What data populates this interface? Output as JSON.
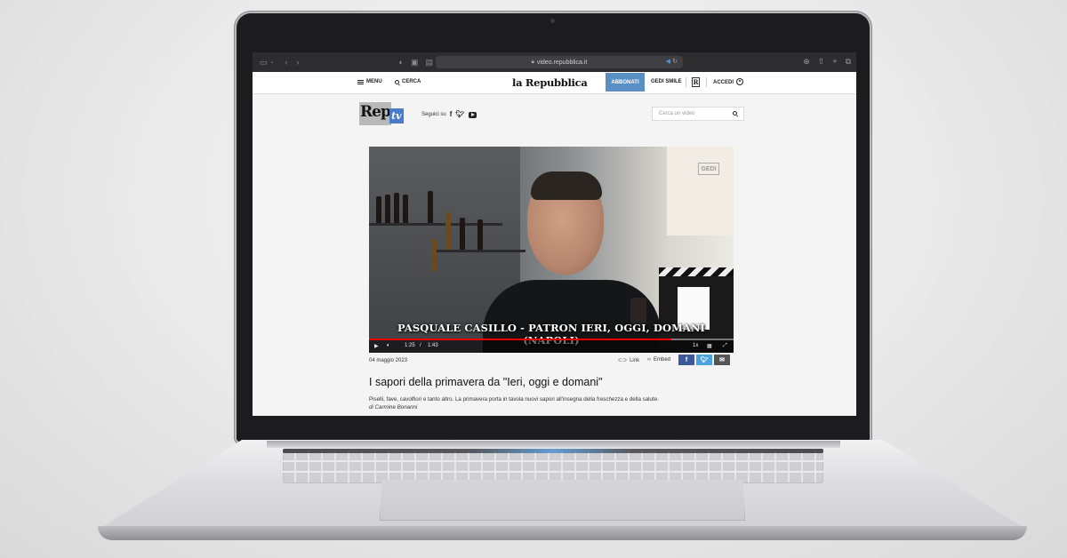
{
  "browser": {
    "url": "video.repubblica.it"
  },
  "header": {
    "menu_label": "MENU",
    "search_label": "CERCA",
    "brand": "la Repubblica",
    "subscribe_label": "ABBONATI",
    "gedi_smile_label": "GEDI SMILE",
    "r_badge": "R",
    "login_label": "ACCEDI"
  },
  "reptv": {
    "logo_rep": "Rep",
    "logo_tv": "tv",
    "follow_label": "Seguici su",
    "social": [
      "facebook-icon",
      "twitter-icon",
      "youtube-icon"
    ],
    "search_placeholder": "Cerca un video"
  },
  "video": {
    "caption": "PASQUALE CASILLO - PATRON IERI, OGGI, DOMANI (NAPOLI)",
    "watermark": "GEDI",
    "current_time": "1:25",
    "time_separator": "/",
    "duration": "1:43",
    "speed": "1x",
    "progress": 0.83
  },
  "article": {
    "date": "04 maggio 2023",
    "link_label": "Link",
    "embed_label": "Embed",
    "title": "I sapori della primavera da \"Ieri, oggi e domani\"",
    "description": "Piselli, fave, cavolfiori e tanto altro. La primavera porta in tavola nuovi sapori all'insegna della freschezza e della salute.",
    "author": "di Carmine Bonanni"
  },
  "colors": {
    "subscribe_bg": "#5a8fc4",
    "reptv_blue": "#4a7cc9",
    "facebook": "#3b5998",
    "twitter": "#4aa3df",
    "mail": "#555555"
  }
}
